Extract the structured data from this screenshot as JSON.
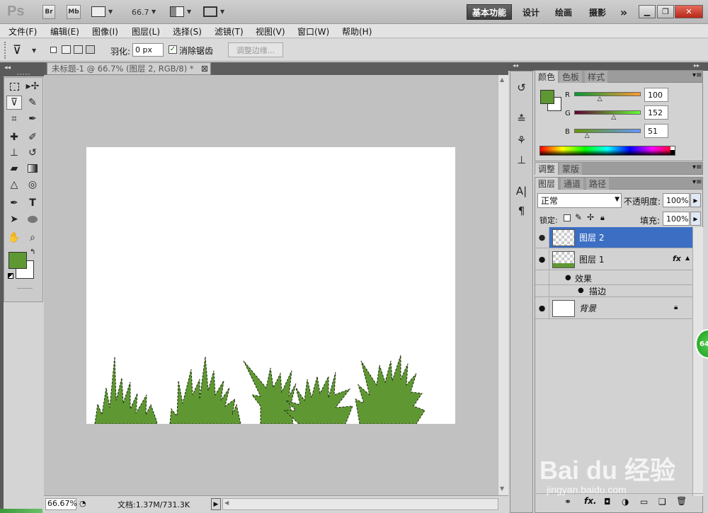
{
  "app": {
    "logo": "Ps",
    "bridge_label": "Br",
    "minibridge_label": "Mb",
    "zoom_value": "66.7"
  },
  "workspaces": {
    "essentials": "基本功能",
    "design": "设计",
    "painting": "绘画",
    "photography": "摄影",
    "more": "»"
  },
  "menu": [
    "文件(F)",
    "编辑(E)",
    "图像(I)",
    "图层(L)",
    "选择(S)",
    "滤镜(T)",
    "视图(V)",
    "窗口(W)",
    "帮助(H)"
  ],
  "options": {
    "feather_label": "羽化:",
    "feather_value": "0 px",
    "antialias_label": "消除锯齿",
    "antialias_checked": true,
    "refine_edge_label": "调整边缘..."
  },
  "document": {
    "tab_title": "未标题-1 @ 66.7% (图层 2, RGB/8) *",
    "close_symbol": "⊠",
    "zoom_status": "66.67%",
    "doc_info": "文档:1.37M/731.3K"
  },
  "colors": {
    "foreground": "#5f9833",
    "background": "#ffffff",
    "grass": "#5f9833"
  },
  "color_panel": {
    "tabs": [
      "颜色",
      "色板",
      "样式"
    ],
    "channels": [
      {
        "label": "R",
        "value": "100",
        "fraction": 0.39
      },
      {
        "label": "G",
        "value": "152",
        "fraction": 0.6
      },
      {
        "label": "B",
        "value": "51",
        "fraction": 0.2
      }
    ]
  },
  "adjust_panel": {
    "tabs": [
      "调整",
      "蒙版"
    ]
  },
  "layers_panel": {
    "tabs": [
      "图层",
      "通道",
      "路径"
    ],
    "blend_mode": "正常",
    "opacity_label": "不透明度:",
    "opacity_value": "100%",
    "lock_label": "锁定:",
    "fill_label": "填充:",
    "fill_value": "100%",
    "layers": [
      {
        "name": "图层 2",
        "selected": true
      },
      {
        "name": "图层 1",
        "selected": false,
        "fx": "fx",
        "effects_label": "效果",
        "effect": "描边"
      },
      {
        "name": "背景",
        "selected": false
      }
    ]
  },
  "badge": "64",
  "watermark": {
    "text": "Bai du 经验",
    "url": "jingyan.baidu.com"
  }
}
